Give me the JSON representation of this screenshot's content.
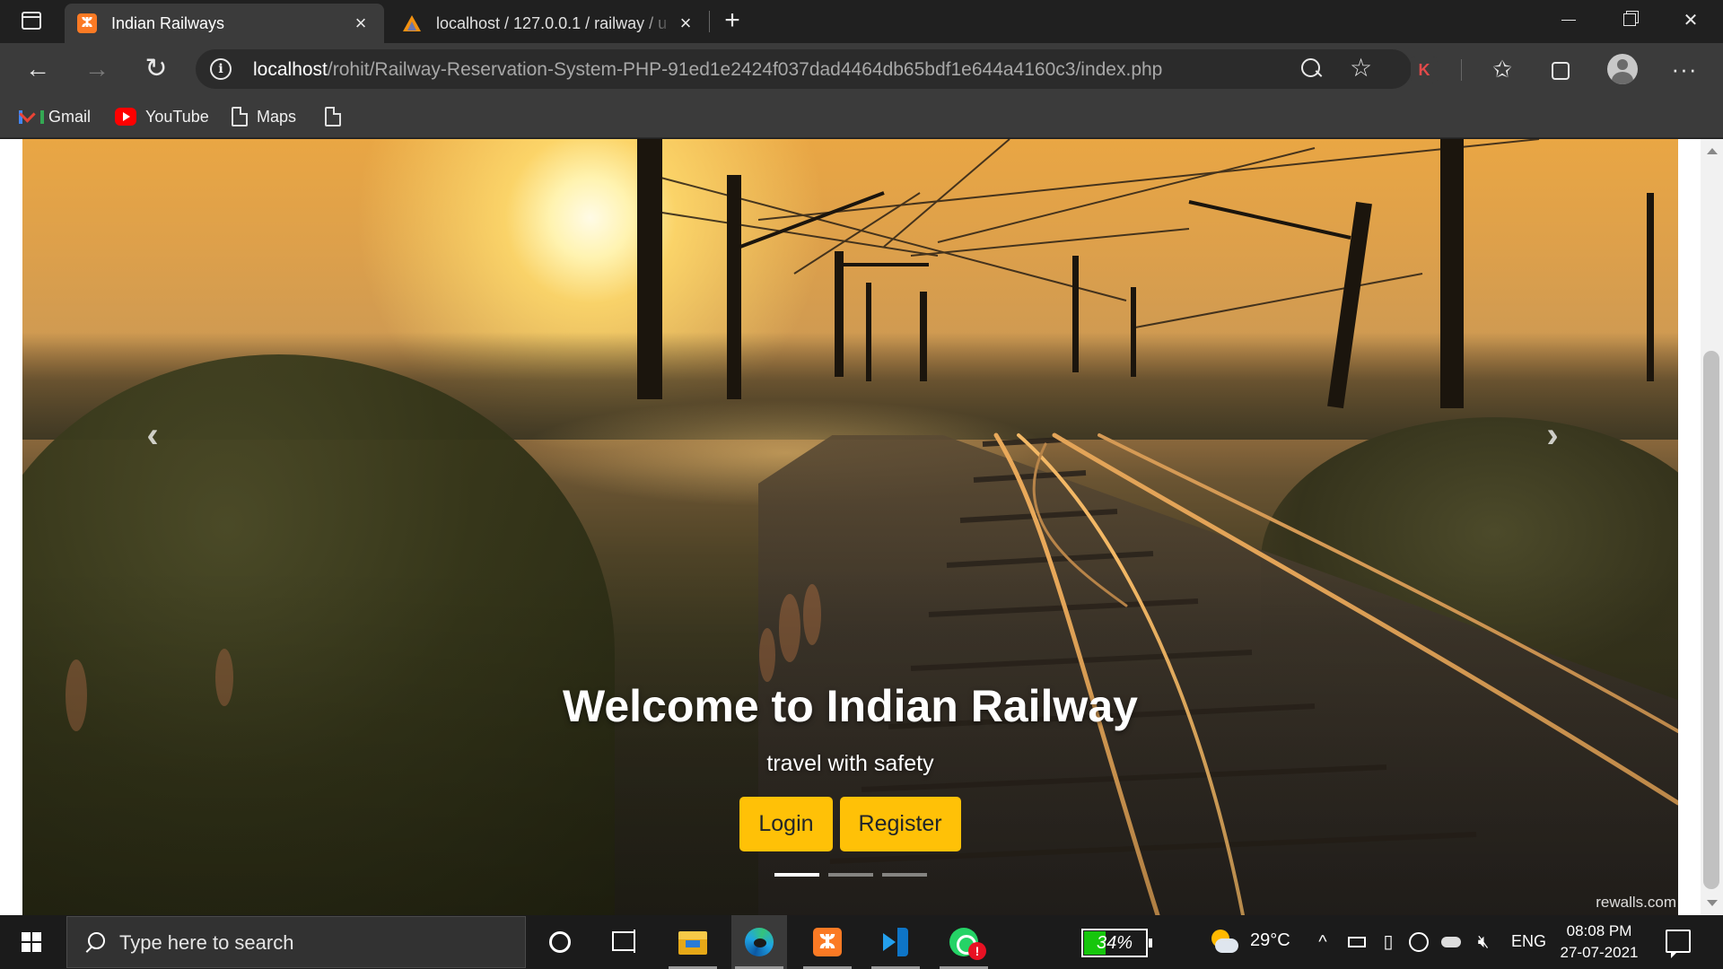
{
  "browser": {
    "tabs": [
      {
        "title": "Indian Railways",
        "active": true,
        "favicon": "xampp-icon"
      },
      {
        "title": "localhost / 127.0.0.1 / railway / u",
        "active": false,
        "favicon": "phpmyadmin-icon"
      }
    ],
    "url_host": "localhost",
    "url_path": "/rohit/Railway-Reservation-System-PHP-91ed1e2424f037dad4464db65bdf1e644a4160c3/index.php",
    "extension_label": "K",
    "bookmarks": [
      {
        "label": "Gmail",
        "icon": "gmail-icon"
      },
      {
        "label": "YouTube",
        "icon": "youtube-icon"
      },
      {
        "label": "Maps",
        "icon": "page-icon"
      },
      {
        "label": "",
        "icon": "page-icon"
      }
    ]
  },
  "hero": {
    "title": "Welcome to Indian Railway",
    "subtitle": "travel with safety",
    "login_label": "Login",
    "register_label": "Register",
    "prev_glyph": "‹",
    "next_glyph": "›",
    "slide_count": 3,
    "active_slide": 1,
    "watermark": "rewalls.com",
    "accent_color": "#ffc107"
  },
  "taskbar": {
    "search_placeholder": "Type here to search",
    "apps": [
      "cortana",
      "task-view",
      "file-explorer",
      "edge",
      "xampp",
      "vscode",
      "whatsapp"
    ],
    "whatsapp_badge": "!",
    "battery_percent": 34,
    "battery_label": "34%",
    "temperature": "29°C",
    "language": "ENG",
    "time": "08:08 PM",
    "date": "27-07-2021"
  }
}
